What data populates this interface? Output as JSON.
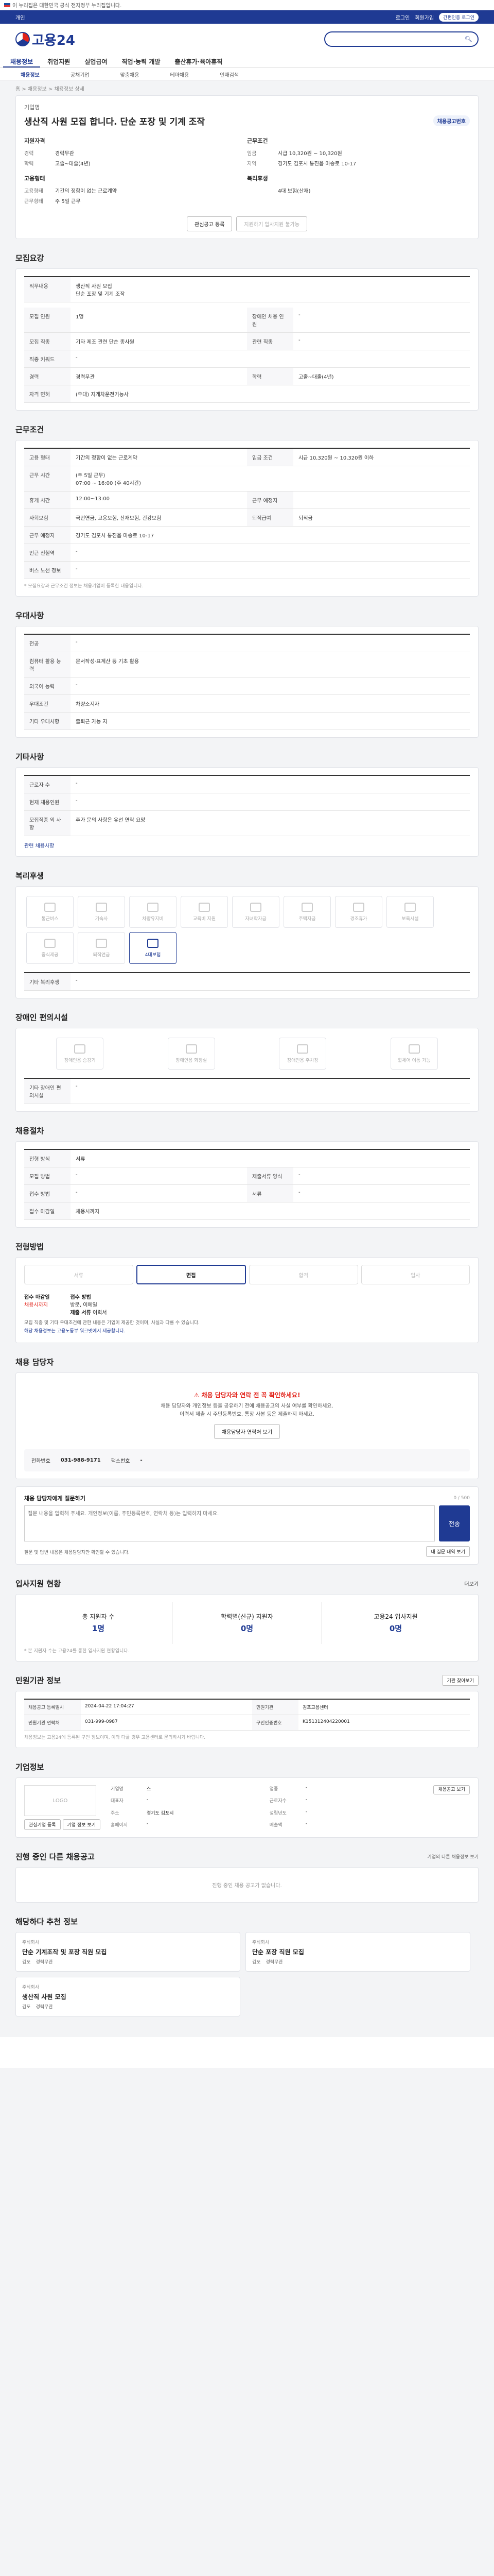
{
  "topbar": {
    "text": "이 누리집은 대한민국 공식 전자정부 누리집입니다."
  },
  "gnb": {
    "left": "개인",
    "right_items": [
      "로그인",
      "회원가입"
    ],
    "cert_label": "간편인증 로그인"
  },
  "header": {
    "logo": "고용24"
  },
  "menu": {
    "items": [
      "채용정보",
      "취업지원",
      "실업급여",
      "직업·능력 개발",
      "출산휴가·육아휴직"
    ],
    "active": 0
  },
  "submenu": {
    "items": [
      "채용정보",
      "공채기업",
      "맞춤채용",
      "테마채용",
      "인재검색"
    ]
  },
  "crumb": "홈 > 채용정보 > 채용정보 상세",
  "title": {
    "company": "기업명",
    "heading": "생산직 사원 모집 합니다. 단순 포장 및 기계 조작",
    "badge": "채용공고번호",
    "left_head": "지원자격",
    "right_head": "근무조건",
    "left_rows": [
      [
        "경력",
        "경력무관"
      ],
      [
        "학력",
        "고졸~대졸(4년)"
      ]
    ],
    "right_rows": [
      [
        "임금",
        "시급 10,320원 ~ 10,320원"
      ],
      [
        "지역",
        "경기도 김포시 통진읍 마송로 10-17"
      ]
    ],
    "left_head2": "고용형태",
    "right_head2": "복리후생",
    "left_rows2": [
      [
        "고용형태",
        "기간의 정함이 없는 근로계약"
      ],
      [
        "근무형태",
        "주 5일 근무"
      ]
    ],
    "right_rows2": [
      [
        "",
        "4대 보험(산재)"
      ]
    ],
    "btn_interest": "관심공고 등록",
    "btn_scrap": "지원하기 입사지원 불가능"
  },
  "recruit": {
    "title": "모집요강",
    "job_title_k": "직무내용",
    "job_title_v": "생산직 사원 모집\n단순 포장 및 기계 조작",
    "rows": [
      [
        "모집 인원",
        "1명",
        "장애인 채용 인원",
        "-"
      ],
      [
        "모집 직종",
        "기타 제조 관련 단순 종사원",
        "관련 직종",
        "-"
      ],
      [
        "직종 키워드",
        "-",
        "",
        ""
      ],
      [
        "경력",
        "경력무관",
        "학력",
        "고졸~대졸(4년)"
      ],
      [
        "자격 면허",
        "(우대) 지게차운전기능사",
        "",
        ""
      ]
    ]
  },
  "work": {
    "title": "근무조건",
    "rows": [
      [
        "고용 형태",
        "기간의 정함이 없는 근로계약",
        "임금 조건",
        "시급 10,320원 ~ 10,320원 이하"
      ],
      [
        "근무 시간",
        "(주 5일 근무)\n07:00 ~ 16:00 (주 40시간)",
        "",
        ""
      ],
      [
        "휴게 시간",
        "12:00~13:00",
        "근무 예정지",
        "",
        ""
      ],
      [
        "사회보험",
        "국민연금, 고용보험, 산재보험, 건강보험",
        "퇴직급여",
        "퇴직금"
      ],
      [
        "근무 예정지",
        "경기도 김포시 통진읍 마송로 10-17",
        "",
        ""
      ],
      [
        "인근 전철역",
        "-",
        "",
        ""
      ],
      [
        "버스 노선 정보",
        "-",
        "",
        ""
      ]
    ],
    "note": "* 모집요강과 근무조건 정보는 채용기업이 등록한 내용입니다."
  },
  "pref": {
    "title": "우대사항",
    "rows": [
      [
        "전공",
        "-"
      ],
      [
        "컴퓨터 활용 능력",
        "문서작성·표계산 등 기초 활용"
      ],
      [
        "외국어 능력",
        "-"
      ],
      [
        "우대조건",
        "차량소지자"
      ],
      [
        "기타 우대사항",
        "출퇴근 가능 자"
      ]
    ]
  },
  "etc": {
    "title": "기타사항",
    "rows": [
      [
        "근로자 수",
        "-"
      ],
      [
        "현재 채용인원",
        "-"
      ],
      [
        "모집직종 외 사항",
        "추가 문의 사항은 유선 연락 요망"
      ]
    ],
    "link": "관련 채용사항"
  },
  "welfare": {
    "title": "복리후생",
    "icons": [
      "통근버스",
      "기숙사",
      "차량유지비",
      "교육비 지원",
      "자녀학자금",
      "주택자금",
      "경조휴가",
      "보육시설",
      "중식제공",
      "퇴직연금",
      "4대보험"
    ],
    "active_index": 10,
    "extra_k": "기타 복리후생",
    "extra_v": "-"
  },
  "disabled": {
    "title": "장애인 편의시설",
    "icons": [
      "장애인용 승강기",
      "장애인용 화장실",
      "장애인용 주차장",
      "휠체어 이동 가능"
    ],
    "extra_k": "기타 장애인 편의시설",
    "extra_v": "-"
  },
  "selection": {
    "title": "채용절차",
    "rows": [
      [
        "전형 방식",
        "서류",
        "",
        ""
      ],
      [
        "모집 방법",
        "-",
        "제출서류 양식",
        "-"
      ],
      [
        "접수 방법",
        "-",
        "서류",
        "-"
      ],
      [
        "접수 마감일",
        "채용시까지",
        "",
        ""
      ]
    ]
  },
  "process": {
    "title": "전형방법",
    "steps": [
      "서류",
      "면접",
      "합격",
      "입사"
    ],
    "active": 1,
    "deadline_k": "접수 마감일",
    "deadline_v": "채용시까지",
    "method_k": "접수 방법",
    "method_v": "방문, 이메일",
    "docs_k": "제출 서류",
    "docs_v": "이력서",
    "bul1": "모집 직종 및 기타 우대조건에 관한 내용은 기업이 제공한 것이며, 사실과 다를 수 있습니다.",
    "bul2": "해당 채용정보는 고용노동부 워크넷에서 제공합니다."
  },
  "manager": {
    "title": "채용 담당자",
    "warn": "채용 담당자와 연락 전 꼭 확인하세요!",
    "p1": "채용 담당자와 개인정보 등을 공유하기 전에 채용공고의 사실 여부를 확인하세요.",
    "p2": "이력서 제출 시 주민등록번호, 통장 사본 등은 제출하지 마세요.",
    "btn": "채용담당자 연락처 보기",
    "phone_k": "전화번호",
    "phone_v": "031-988-9171",
    "fax_k": "팩스번호",
    "fax_v": "-"
  },
  "inquiry": {
    "title": "채용 담당자에게 질문하기",
    "counter": "0 / 500",
    "placeholder": "질문 내용을 입력해 주세요. 개인정보(이름, 주민등록번호, 연락처 등)는 입력하지 마세요.",
    "send": "전송",
    "bul": "질문 및 답변 내용은 채용담당자만 확인할 수 있습니다.",
    "btn_list": "내 질문 내역 보기"
  },
  "status": {
    "title": "입사지원 현황",
    "btn": "더보기",
    "items": [
      [
        "총 지원자 수",
        "1명"
      ],
      [
        "학력별(신규) 지원자",
        "0명"
      ],
      [
        "고용24 입사지원",
        "0명"
      ]
    ],
    "note": "* 본 지원자 수는 고용24를 통한 입사지원 현황입니다."
  },
  "agency": {
    "title": "민원기관 정보",
    "btn": "기관 찾아보기",
    "rows": [
      [
        "채용공고 등록일시",
        "2024-04-22 17:04:27",
        "민원기관",
        "김포고용센터"
      ],
      [
        "민원기관 연락처",
        "031-999-0987",
        "구인인증번호",
        "K151312404220001"
      ]
    ],
    "bul": "채용정보는 고용24에 등록된 구인 정보이며, 이와 다를 경우 고용센터로 문의하시기 바랍니다."
  },
  "company": {
    "title": "기업정보",
    "logo": "LOGO",
    "btn1": "관심기업 등록",
    "btn2": "기업 정보 보기",
    "rows": [
      [
        "기업명",
        "스",
        "업종",
        "-"
      ],
      [
        "대표자",
        "-",
        "근로자수",
        "-"
      ],
      [
        "주소",
        "경기도 김포시",
        "설립년도",
        "-"
      ],
      [
        "홈페이지",
        "-",
        "매출액",
        "-"
      ]
    ],
    "btn_more": "채용공고 보기"
  },
  "others": {
    "title": "진행 중인 다른 채용공고",
    "btn": "기업의 다른 채용정보 보기",
    "empty": "진행 중인 채용 공고가 없습니다."
  },
  "reco": {
    "title": "해당하다 추천 정보",
    "items": [
      {
        "co": "주식회사",
        "t": "단순 기계조작 및 포장 직원 모집",
        "m1": "김포",
        "m2": "경력무관"
      },
      {
        "co": "주식회사",
        "t": "단순 포장 직원 모집",
        "m1": "김포",
        "m2": "경력무관"
      },
      {
        "co": "주식회사",
        "t": "생산직 사원 모집",
        "m1": "김포",
        "m2": "경력무관"
      }
    ]
  }
}
